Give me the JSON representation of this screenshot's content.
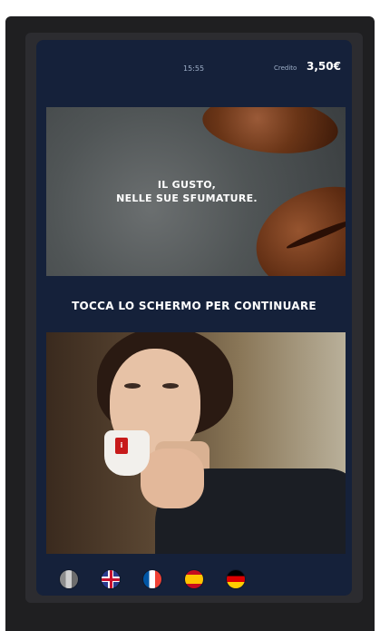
{
  "status": {
    "time": "15:55",
    "credit_label": "Credito",
    "credit_value": "3,50€"
  },
  "banner": {
    "line1": "IL GUSTO,",
    "line2": "NELLE SUE SFUMATURE."
  },
  "prompt": "TOCCA LO SCHERMO PER CONTINUARE",
  "photo": {
    "cup_logo": "i"
  },
  "languages": [
    {
      "name": "italian-flag-icon"
    },
    {
      "name": "uk-flag-icon"
    },
    {
      "name": "french-flag-icon"
    },
    {
      "name": "spanish-flag-icon"
    },
    {
      "name": "german-flag-icon"
    }
  ]
}
